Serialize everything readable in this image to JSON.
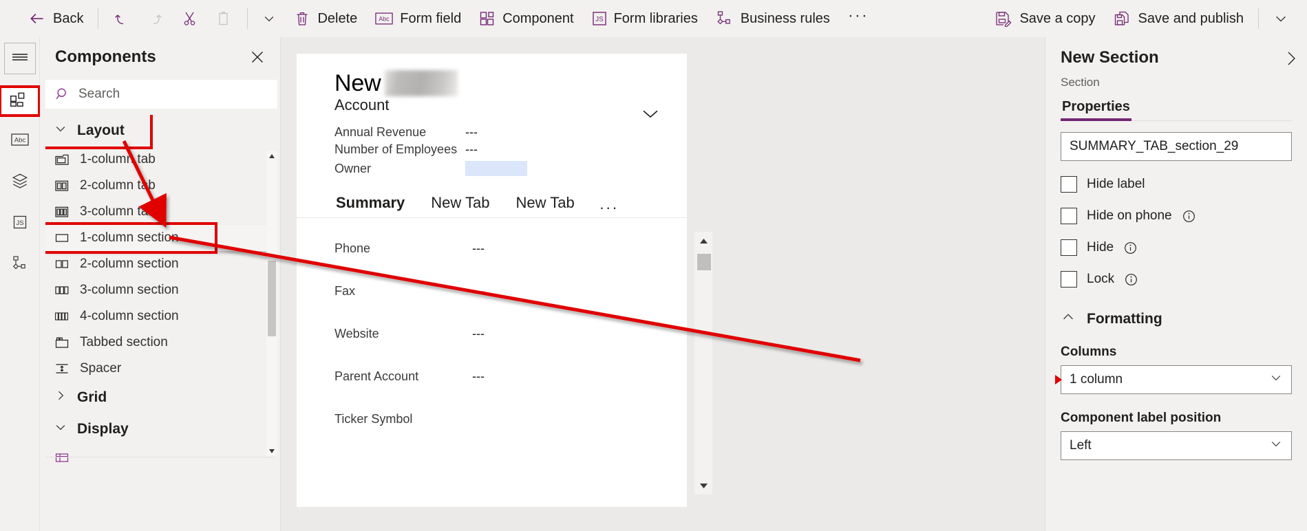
{
  "toolbar": {
    "back_label": "Back",
    "undo_label": "undo-icon",
    "redo_label": "redo-icon",
    "cut_label": "cut-icon",
    "paste_label": "paste-icon",
    "delete_label": "Delete",
    "form_field_label": "Form field",
    "component_label": "Component",
    "form_libraries_label": "Form libraries",
    "business_rules_label": "Business rules",
    "overflow_label": "···",
    "save_copy_label": "Save a copy",
    "save_publish_label": "Save and publish"
  },
  "rail": {
    "items": [
      {
        "name": "menu",
        "label": "hamburger-icon"
      },
      {
        "name": "components",
        "label": "components-icon"
      },
      {
        "name": "form-fields",
        "label": "abc-icon"
      },
      {
        "name": "layers",
        "label": "layers-icon"
      },
      {
        "name": "scripts",
        "label": "js-icon"
      },
      {
        "name": "business-rules",
        "label": "business-rules-icon"
      }
    ]
  },
  "components_panel": {
    "title": "Components",
    "close_label": "✕",
    "search_placeholder": "Search",
    "search_value": "",
    "groups": [
      {
        "label": "Layout",
        "expanded": true,
        "items": [
          {
            "label": "1-column tab",
            "icon": "one-column-tab-icon"
          },
          {
            "label": "2-column tab",
            "icon": "two-column-tab-icon"
          },
          {
            "label": "3-column tab",
            "icon": "three-column-tab-icon"
          },
          {
            "label": "1-column section",
            "icon": "one-column-section-icon"
          },
          {
            "label": "2-column section",
            "icon": "two-column-section-icon"
          },
          {
            "label": "3-column section",
            "icon": "three-column-section-icon"
          },
          {
            "label": "4-column section",
            "icon": "four-column-section-icon"
          },
          {
            "label": "Tabbed section",
            "icon": "tabbed-section-icon"
          },
          {
            "label": "Spacer",
            "icon": "spacer-icon"
          }
        ]
      },
      {
        "label": "Grid",
        "expanded": false,
        "items": []
      },
      {
        "label": "Display",
        "expanded": true,
        "items": []
      }
    ]
  },
  "canvas": {
    "record_title": "New",
    "record_entity": "Account",
    "header_fields": [
      {
        "label": "Annual Revenue",
        "value": "---"
      },
      {
        "label": "Number of Employees",
        "value": "---"
      },
      {
        "label": "Owner",
        "value": ""
      }
    ],
    "tabs": [
      {
        "label": "Summary",
        "active": true
      },
      {
        "label": "New Tab",
        "active": false
      },
      {
        "label": "New Tab",
        "active": false
      }
    ],
    "tabs_overflow": "···",
    "body_fields": [
      {
        "label": "Phone",
        "value": "---"
      },
      {
        "label": "Fax",
        "value": "---"
      },
      {
        "label": "Website",
        "value": "---"
      },
      {
        "label": "Parent Account",
        "value": "---"
      },
      {
        "label": "Ticker Symbol",
        "value": ""
      }
    ]
  },
  "properties": {
    "title": "New Section",
    "subtitle": "Section",
    "tab_label": "Properties",
    "name_value": "SUMMARY_TAB_section_29",
    "checkboxes": [
      {
        "label": "Hide label",
        "checked": false,
        "info": false
      },
      {
        "label": "Hide on phone",
        "checked": false,
        "info": true
      },
      {
        "label": "Hide",
        "checked": false,
        "info": true
      },
      {
        "label": "Lock",
        "checked": false,
        "info": true
      }
    ],
    "formatting_label": "Formatting",
    "columns_label": "Columns",
    "columns_value": "1 column",
    "label_position_label": "Component label position",
    "label_position_value": "Left"
  },
  "colors": {
    "accent": "#742774",
    "tab_accent": "#1f6fd0",
    "annotation": "#e00000",
    "chrome": "#f2f1f0"
  }
}
